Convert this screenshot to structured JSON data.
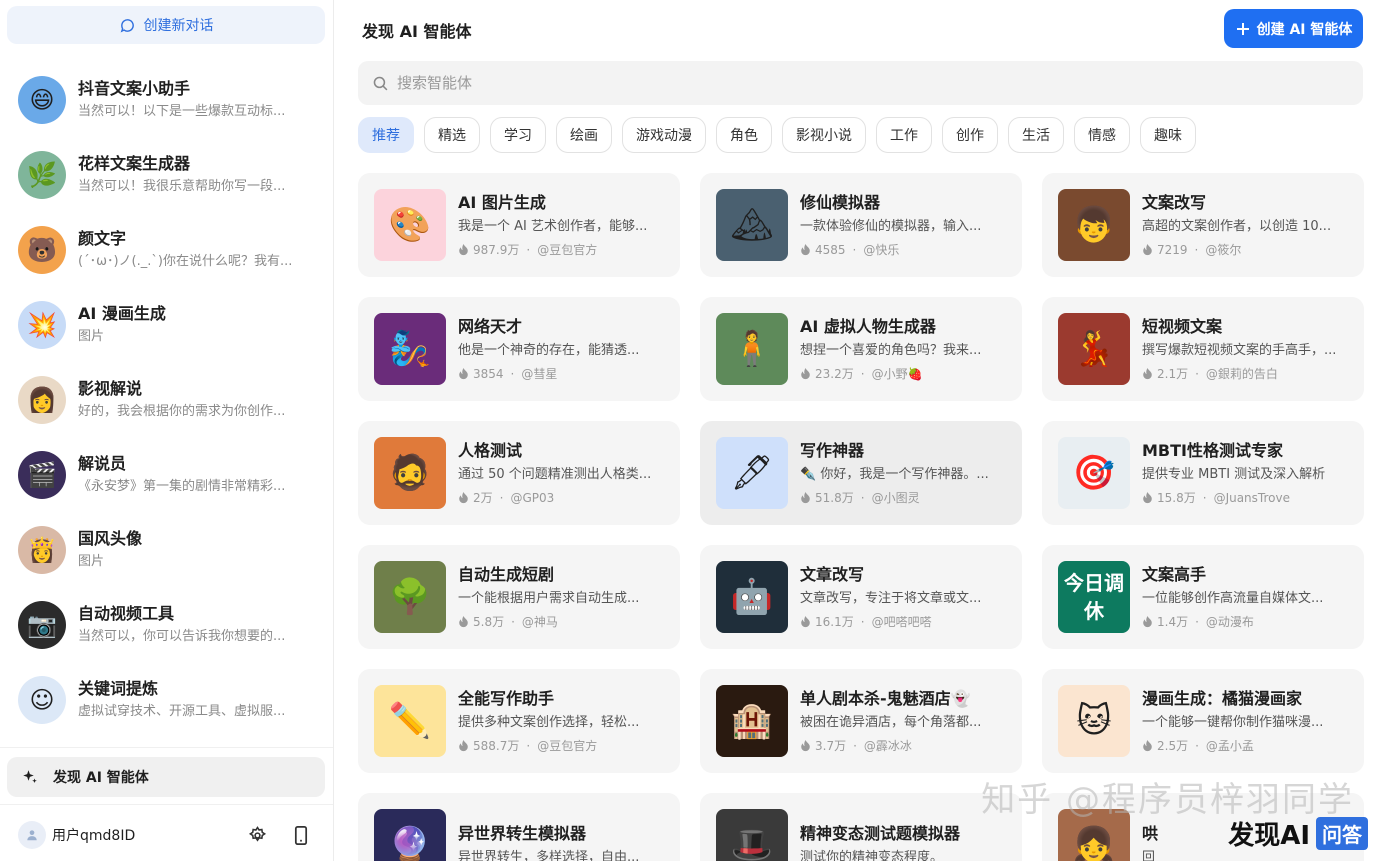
{
  "sidebar": {
    "new_chat_label": "创建新对话",
    "chats": [
      {
        "title": "抖音文案小助手",
        "subtitle": "当然可以！以下是一些爆款互动标...",
        "avatar_color": "#6aa9e8",
        "avatar_glyph": "😄"
      },
      {
        "title": "花样文案生成器",
        "subtitle": "当然可以！我很乐意帮助你写一段...",
        "avatar_color": "#7fb59a",
        "avatar_glyph": "🌿"
      },
      {
        "title": "颜文字",
        "subtitle": "(´･ω･)ノ(._.`)你在说什么呢？我有...",
        "avatar_color": "#f3a24c",
        "avatar_glyph": "🐻"
      },
      {
        "title": "AI 漫画生成",
        "subtitle": "图片",
        "avatar_color": "#c7dbf7",
        "avatar_glyph": "💥"
      },
      {
        "title": "影视解说",
        "subtitle": "好的，我会根据你的需求为你创作...",
        "avatar_color": "#e9d9c6",
        "avatar_glyph": "👩"
      },
      {
        "title": "解说员",
        "subtitle": "《永安梦》第一集的剧情非常精彩...",
        "avatar_color": "#3a2d5a",
        "avatar_glyph": "🎬"
      },
      {
        "title": "国风头像",
        "subtitle": "图片",
        "avatar_color": "#d9b9a6",
        "avatar_glyph": "👸"
      },
      {
        "title": "自动视频工具",
        "subtitle": "当然可以，你可以告诉我你想要的...",
        "avatar_color": "#2b2b2b",
        "avatar_glyph": "📷"
      },
      {
        "title": "关键词提炼",
        "subtitle": "虚拟试穿技术、开源工具、虚拟服...",
        "avatar_color": "#dce8f7",
        "avatar_glyph": "☺"
      }
    ],
    "discover_label": "发现 AI 智能体",
    "user_name": "用户qmd8ID"
  },
  "header": {
    "title": "发现 AI 智能体",
    "create_label": "创建 AI 智能体"
  },
  "search": {
    "placeholder": "搜索智能体"
  },
  "tabs": [
    "推荐",
    "精选",
    "学习",
    "绘画",
    "游戏动漫",
    "角色",
    "影视小说",
    "工作",
    "创作",
    "生活",
    "情感",
    "趣味"
  ],
  "cards": [
    {
      "title": "AI 图片生成",
      "desc": "我是一个 AI 艺术创作者，能够...",
      "count": "987.9万",
      "author": "@豆包官方",
      "thumb_color": "#fcd3dc",
      "glyph": "🎨"
    },
    {
      "title": "修仙模拟器",
      "desc": "一款体验修仙的模拟器，输入...",
      "count": "4585",
      "author": "@快乐",
      "thumb_color": "#4a6070",
      "glyph": "🏔"
    },
    {
      "title": "文案改写",
      "desc": "高超的文案创作者，以创造 10...",
      "count": "7219",
      "author": "@筱尔",
      "thumb_color": "#7a4a2f",
      "glyph": "👦"
    },
    {
      "title": "网络天才",
      "desc": "他是一个神奇的存在，能猜透...",
      "count": "3854",
      "author": "@彗星",
      "thumb_color": "#6a2c7a",
      "glyph": "🧞"
    },
    {
      "title": "AI 虚拟人物生成器",
      "desc": "想捏一个喜爱的角色吗？我来...",
      "count": "23.2万",
      "author": "@小野🍓",
      "thumb_color": "#5e8a5a",
      "glyph": "🧍"
    },
    {
      "title": "短视频文案",
      "desc": "撰写爆款短视频文案的手高手，...",
      "count": "2.1万",
      "author": "@銀莉的告白",
      "thumb_color": "#9b3a2f",
      "glyph": "💃"
    },
    {
      "title": "人格测试",
      "desc": "通过 50 个问题精准测出人格类...",
      "count": "2万",
      "author": "@GP03",
      "thumb_color": "#e07a3a",
      "glyph": "🧔"
    },
    {
      "title": "写作神器",
      "desc": "✒️ 你好，我是一个写作神器。...",
      "count": "51.8万",
      "author": "@小图灵",
      "thumb_color": "#cfe0fb",
      "glyph": "🖋"
    },
    {
      "title": "MBTI性格测试专家",
      "desc": "提供专业 MBTI 测试及深入解析",
      "count": "15.8万",
      "author": "@JuansTrove",
      "thumb_color": "#e8eef2",
      "glyph": "🎯"
    },
    {
      "title": "自动生成短剧",
      "desc": "一个能根据用户需求自动生成...",
      "count": "5.8万",
      "author": "@神马",
      "thumb_color": "#6f7f4a",
      "glyph": "🌳"
    },
    {
      "title": "文章改写",
      "desc": "文章改写，专注于将文章或文...",
      "count": "16.1万",
      "author": "@吧嗒吧嗒",
      "thumb_color": "#1f2e3a",
      "glyph": "🤖"
    },
    {
      "title": "文案高手",
      "desc": "一位能够创作高流量自媒体文...",
      "count": "1.4万",
      "author": "@动漫布",
      "thumb_color": "#0d7a5f",
      "glyph": "今日调休"
    },
    {
      "title": "全能写作助手",
      "desc": "提供多种文案创作选择，轻松...",
      "count": "588.7万",
      "author": "@豆包官方",
      "thumb_color": "#fde49a",
      "glyph": "✏️"
    },
    {
      "title": "单人剧本杀-鬼魅酒店👻",
      "desc": "被困在诡异酒店，每个角落都...",
      "count": "3.7万",
      "author": "@霹冰冰",
      "thumb_color": "#2a1a10",
      "glyph": "🏨"
    },
    {
      "title": "漫画生成：橘猫漫画家",
      "desc": "一个能够一键帮你制作猫咪漫...",
      "count": "2.5万",
      "author": "@孟小孟",
      "thumb_color": "#fbe5d0",
      "glyph": "🐱"
    },
    {
      "title": "异世界转生模拟器",
      "desc": "异世界转生，多样选择，自由...",
      "count": "",
      "author": "",
      "thumb_color": "#2a2a5a",
      "glyph": "🔮"
    },
    {
      "title": "精神变态测试题模拟器",
      "desc": "测试你的精神变态程度。",
      "count": "",
      "author": "",
      "thumb_color": "#3a3a3a",
      "glyph": "🎩"
    },
    {
      "title": "哄",
      "desc": "回",
      "count": "",
      "author": "",
      "thumb_color": "#a56a4a",
      "glyph": "👧"
    }
  ],
  "watermark": "知乎 @程序员梓羽同学",
  "brand": {
    "text": "发现AI",
    "badge": "问答"
  }
}
